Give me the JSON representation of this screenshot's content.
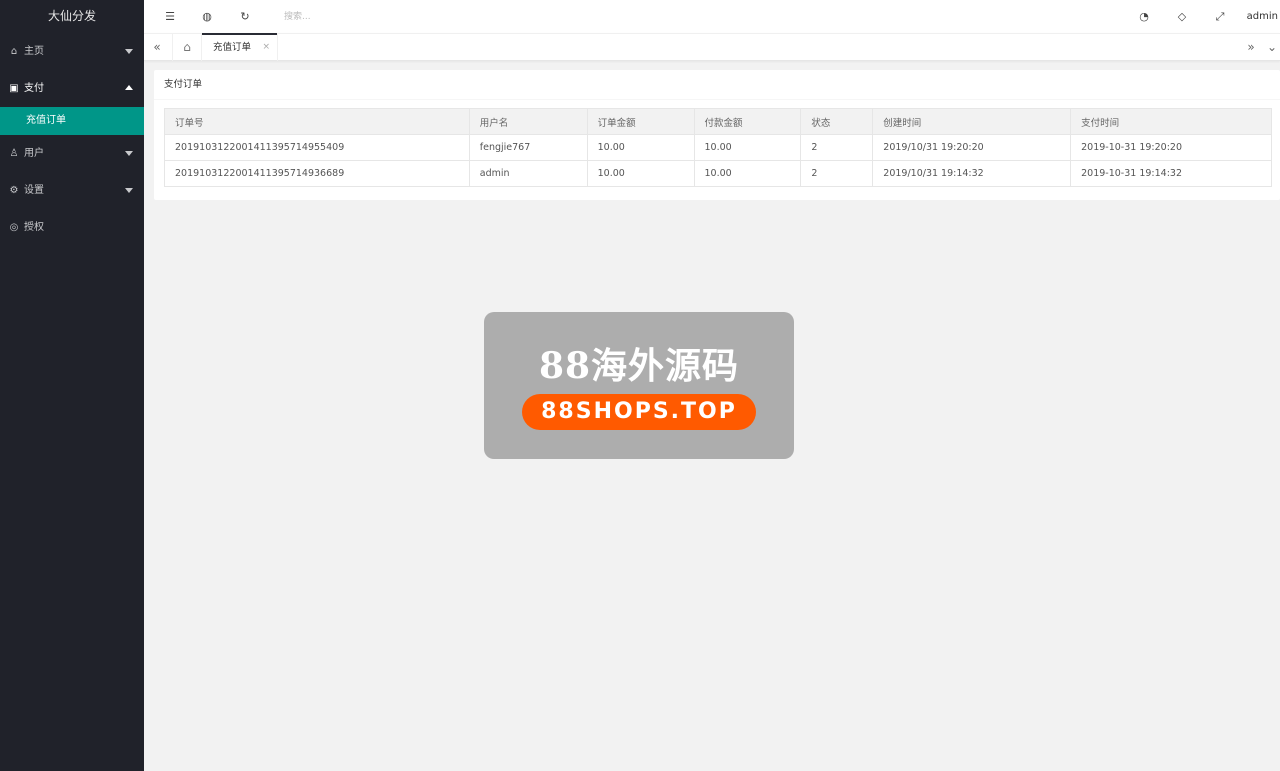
{
  "app": {
    "title": "大仙分发"
  },
  "sidebar": {
    "items": [
      {
        "label": "主页",
        "icon": "home-icon"
      },
      {
        "label": "支付",
        "icon": "payment-icon"
      },
      {
        "label": "用户",
        "icon": "user-icon"
      },
      {
        "label": "设置",
        "icon": "gear-icon"
      },
      {
        "label": "授权",
        "icon": "shield-check-icon"
      }
    ],
    "sub_items": [
      {
        "label": "充值订单"
      }
    ]
  },
  "header": {
    "search_placeholder": "搜索...",
    "user": "admin"
  },
  "tabs": [
    {
      "label": "充值订单",
      "close": "×"
    }
  ],
  "card": {
    "title": "支付订单"
  },
  "table": {
    "columns": [
      "订单号",
      "用户名",
      "订单金额",
      "付款金额",
      "状态",
      "创建时间",
      "支付时间"
    ],
    "rows": [
      [
        "20191031220014113957149554​09",
        "fengjie767",
        "10.00",
        "10.00",
        "2",
        "2019/10/31 19:20:20",
        "2019-10-31 19:20:20"
      ],
      [
        "2019103122001411395714936689",
        "admin",
        "10.00",
        "10.00",
        "2",
        "2019/10/31 19:14:32",
        "2019-10-31 19:14:32"
      ]
    ]
  },
  "watermark": {
    "title": "88海外源码",
    "subtitle": "88SHOPS.TOP"
  },
  "colors": {
    "sidebar_bg": "#20222a",
    "accent": "#009688",
    "watermark_orange": "#ff5a00"
  }
}
